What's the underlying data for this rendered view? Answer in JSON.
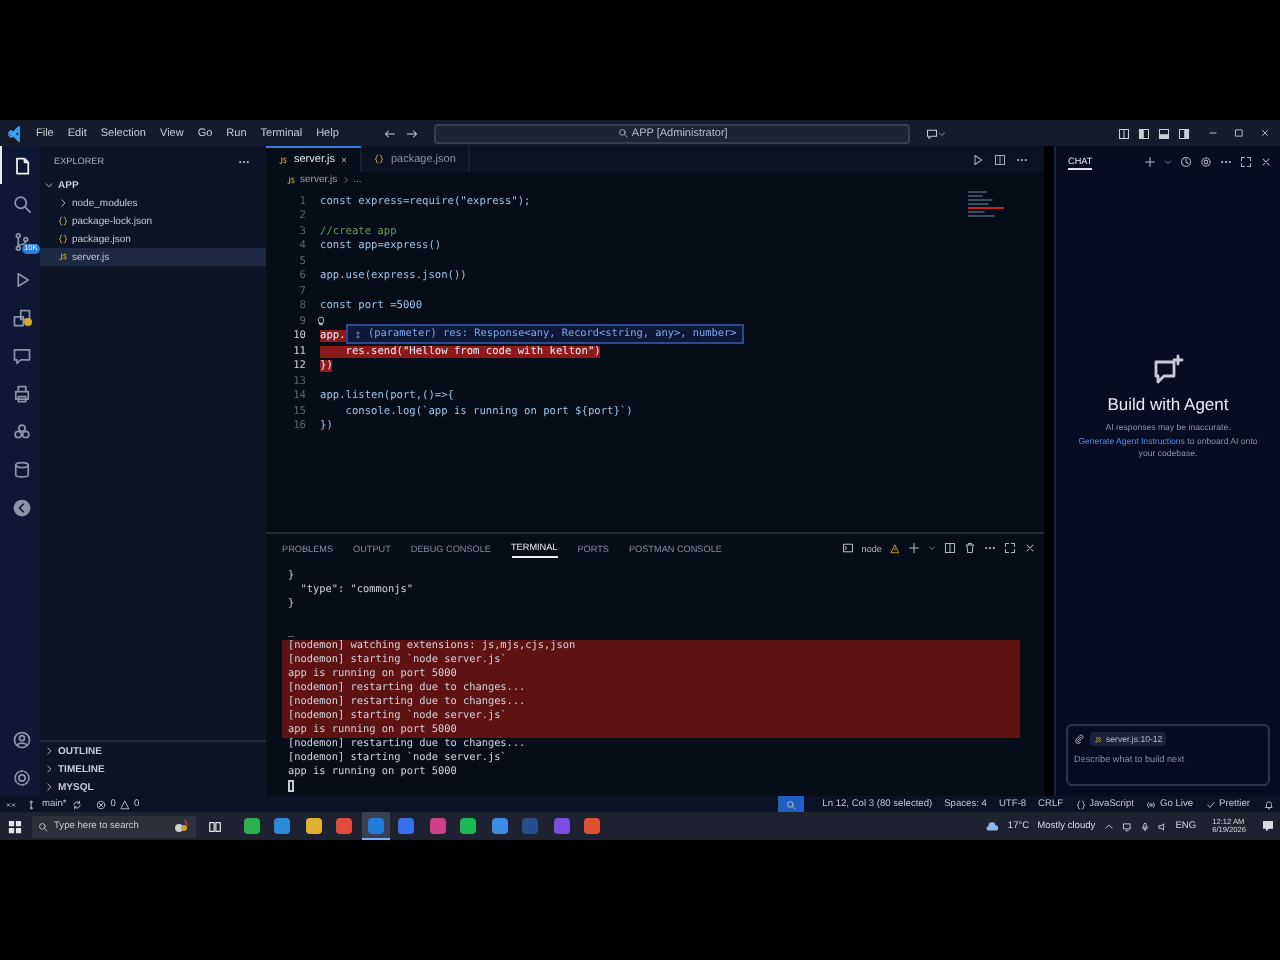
{
  "title_bar": {
    "menu": [
      "File",
      "Edit",
      "Selection",
      "View",
      "Go",
      "Run",
      "Terminal",
      "Help"
    ],
    "search": "APP [Administrator]"
  },
  "activity_bar": {
    "items": [
      {
        "selected": true
      },
      {
        "selected": false
      },
      {
        "selected": false,
        "badge": "10K"
      },
      {
        "selected": false
      },
      {
        "selected": false
      },
      {
        "selected": false
      },
      {
        "selected": false
      },
      {
        "selected": false
      },
      {
        "selected": false
      },
      {
        "selected": false
      }
    ]
  },
  "sidebar": {
    "title": "EXPLORER",
    "folder": {
      "label": "APP",
      "expanded": true,
      "children": [
        {
          "label": "node_modules",
          "kind": "folder",
          "expanded": false,
          "selected": false
        },
        {
          "label": "package-lock.json",
          "kind": "json",
          "selected": false
        },
        {
          "label": "package.json",
          "kind": "json",
          "selected": false
        },
        {
          "label": "server.js",
          "kind": "js",
          "selected": true
        }
      ]
    },
    "sections": [
      {
        "label": "OUTLINE",
        "expanded": false
      },
      {
        "label": "TIMELINE",
        "expanded": false
      },
      {
        "label": "MYSQL",
        "expanded": false
      }
    ]
  },
  "editor": {
    "tabs": [
      {
        "label": "server.js",
        "kind": "js",
        "selected": true
      },
      {
        "label": "package.json",
        "kind": "json",
        "selected": false
      }
    ],
    "breadcrumb": [
      "server.js",
      "..."
    ],
    "lines": [
      {
        "number": "1",
        "text": "const express=require(\"express\");",
        "kind": "code",
        "selected": false,
        "lightbulb": false
      },
      {
        "number": "2",
        "kind": "blank",
        "selected": false,
        "lightbulb": false
      },
      {
        "number": "3",
        "text": "//create app",
        "kind": "comment",
        "selected": false,
        "lightbulb": false
      },
      {
        "number": "4",
        "text": "const app=express()",
        "kind": "code",
        "selected": false,
        "lightbulb": false
      },
      {
        "number": "5",
        "kind": "blank",
        "selected": false,
        "lightbulb": false
      },
      {
        "number": "6",
        "text": "app.use(express.json())",
        "kind": "code",
        "selected": false,
        "lightbulb": false
      },
      {
        "number": "7",
        "kind": "blank",
        "selected": false,
        "lightbulb": false
      },
      {
        "number": "8",
        "text": "const port =5000",
        "kind": "code",
        "selected": false,
        "lightbulb": false
      },
      {
        "number": "9",
        "kind": "blank",
        "selected": false,
        "lightbulb": true
      },
      {
        "number": "10",
        "text": "app.",
        "kind": "code",
        "selected": true,
        "lightbulb": false
      },
      {
        "number": "11",
        "text": "    res.send(\"Hellow from code with kelton\")",
        "kind": "code",
        "selected": true,
        "lightbulb": false
      },
      {
        "number": "12",
        "text": "})",
        "kind": "code",
        "selected": true,
        "lightbulb": false
      },
      {
        "number": "13",
        "kind": "blank",
        "selected": false,
        "lightbulb": false
      },
      {
        "number": "14",
        "text": "app.listen(port,()=>{",
        "kind": "code",
        "selected": false,
        "lightbulb": false
      },
      {
        "number": "15",
        "text": "    console.log(`app is running on port ${port}`)",
        "kind": "code",
        "selected": false,
        "lightbulb": false
      },
      {
        "number": "16",
        "text": "})",
        "kind": "code",
        "selected": false,
        "lightbulb": false
      }
    ],
    "hover": "(parameter) res: Response<any, Record<string, any>, number>"
  },
  "panel": {
    "tabs": [
      {
        "label": "PROBLEMS",
        "selected": false
      },
      {
        "label": "OUTPUT",
        "selected": false
      },
      {
        "label": "DEBUG CONSOLE",
        "selected": false
      },
      {
        "label": "TERMINAL",
        "selected": true
      },
      {
        "label": "PORTS",
        "selected": false
      },
      {
        "label": "POSTMAN CONSOLE",
        "selected": false
      }
    ],
    "terminal_name": "node",
    "lines": [
      {
        "kind": "text",
        "text": "}",
        "selected": false
      },
      {
        "kind": "text",
        "text": "  \"type\": \"commonjs\"",
        "selected": false
      },
      {
        "kind": "text",
        "text": "}",
        "selected": false
      },
      {
        "kind": "prompt",
        "text": "_",
        "selected": false
      },
      {
        "kind": "text",
        "text": "[nodemon] watching extensions: js,mjs,cjs,json",
        "selected": true
      },
      {
        "kind": "text",
        "text": "[nodemon] starting `node server.js`",
        "selected": true
      },
      {
        "kind": "text",
        "text": "app is running on port 5000",
        "selected": true
      },
      {
        "kind": "text",
        "text": "[nodemon] restarting due to changes...",
        "selected": true
      },
      {
        "kind": "text",
        "text": "[nodemon] restarting due to changes...",
        "selected": true
      },
      {
        "kind": "text",
        "text": "[nodemon] starting `node server.js`",
        "selected": true
      },
      {
        "kind": "text",
        "text": "app is running on port 5000",
        "selected": true
      },
      {
        "kind": "text",
        "text": "[nodemon] restarting due to changes...",
        "selected": false
      },
      {
        "kind": "text",
        "text": "[nodemon] starting `node server.js`",
        "selected": false
      },
      {
        "kind": "text",
        "text": "app is running on port 5000",
        "selected": false
      },
      {
        "kind": "cursor",
        "selected": false
      }
    ]
  },
  "chat": {
    "title": "CHAT",
    "heading": "Build with Agent",
    "note": "AI responses may be inaccurate.",
    "link": "Generate Agent Instructions",
    "link_rest": "to onboard AI onto your codebase.",
    "context": "server.js:10-12",
    "placeholder": "Describe what to build next"
  },
  "status_bar": {
    "branch": "main*",
    "errors": "0",
    "warnings": "0",
    "items": [
      {
        "text": "Ln 12, Col 3 (80 selected)",
        "kind": "plain"
      },
      {
        "text": "Spaces: 4",
        "kind": "plain"
      },
      {
        "text": "UTF-8",
        "kind": "plain"
      },
      {
        "text": "CRLF",
        "kind": "plain"
      },
      {
        "text": "JavaScript",
        "kind": "language"
      },
      {
        "text": "Go Live",
        "kind": "live"
      },
      {
        "text": "Prettier",
        "kind": "check"
      }
    ]
  },
  "taskbar": {
    "search_placeholder": "Type here to search",
    "apps": [
      {
        "selected": false
      },
      {
        "selected": false
      },
      {
        "selected": false
      },
      {
        "selected": false
      },
      {
        "selected": true
      },
      {
        "selected": false
      },
      {
        "selected": false
      },
      {
        "selected": false
      },
      {
        "selected": false
      },
      {
        "selected": false
      },
      {
        "selected": false
      },
      {
        "selected": false
      }
    ],
    "temperature": "17°C",
    "weather": "Mostly cloudy",
    "language": "ENG",
    "time": "12:12 AM",
    "date": "6/19/2026"
  }
}
